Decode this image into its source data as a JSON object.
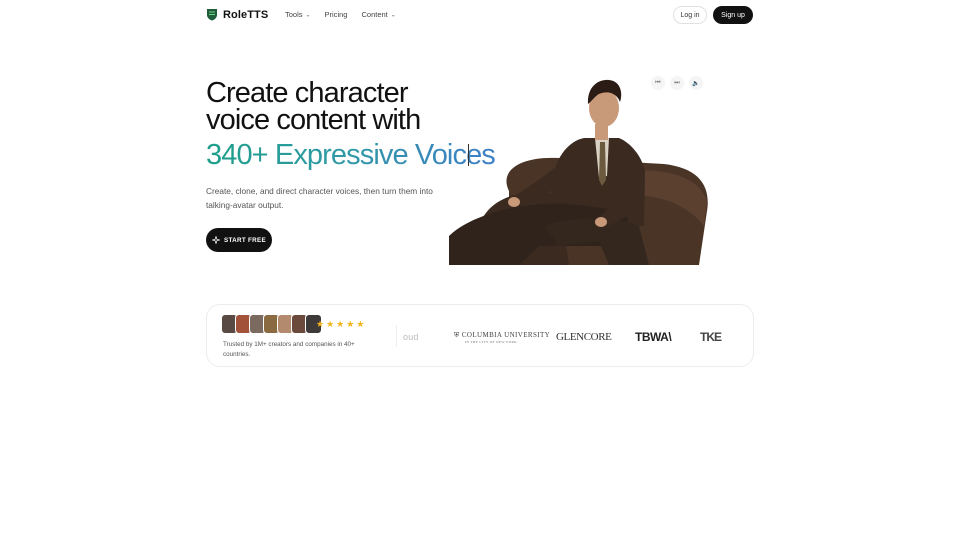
{
  "nav": {
    "brand": "RoleTTS",
    "links": [
      {
        "label": "Tools",
        "has_dropdown": true
      },
      {
        "label": "Pricing",
        "has_dropdown": false
      },
      {
        "label": "Content",
        "has_dropdown": true
      }
    ],
    "login_label": "Log in",
    "signup_label": "Sign up"
  },
  "hero": {
    "title_line1": "Create character",
    "title_line2": "voice content with",
    "accent": "340+ Expressive Voices",
    "subtitle": "Create, clone, and direct character voices, then turn them into talking-avatar output.",
    "cta_label": "START FREE",
    "cta_icon": "sparkle-icon"
  },
  "player": {
    "controls": [
      "skip-back-icon",
      "skip-forward-icon",
      "volume-icon"
    ]
  },
  "trust": {
    "rating_stars": 5,
    "text": "Trusted by 1M+ creators and companies in 40+ countries.",
    "logos": {
      "partial": "oud",
      "columbia_line1": "COLUMBIA UNIVERSITY",
      "columbia_line2": "IN THE CITY OF NEW YORK",
      "glencore": "GLENCORE",
      "tbwa": "TBWA\\",
      "tk": "TKE"
    }
  },
  "colors": {
    "accent_start": "#1c9e8a",
    "accent_end": "#3f7fc8",
    "button_dark": "#111111",
    "star": "#f3b51c"
  }
}
